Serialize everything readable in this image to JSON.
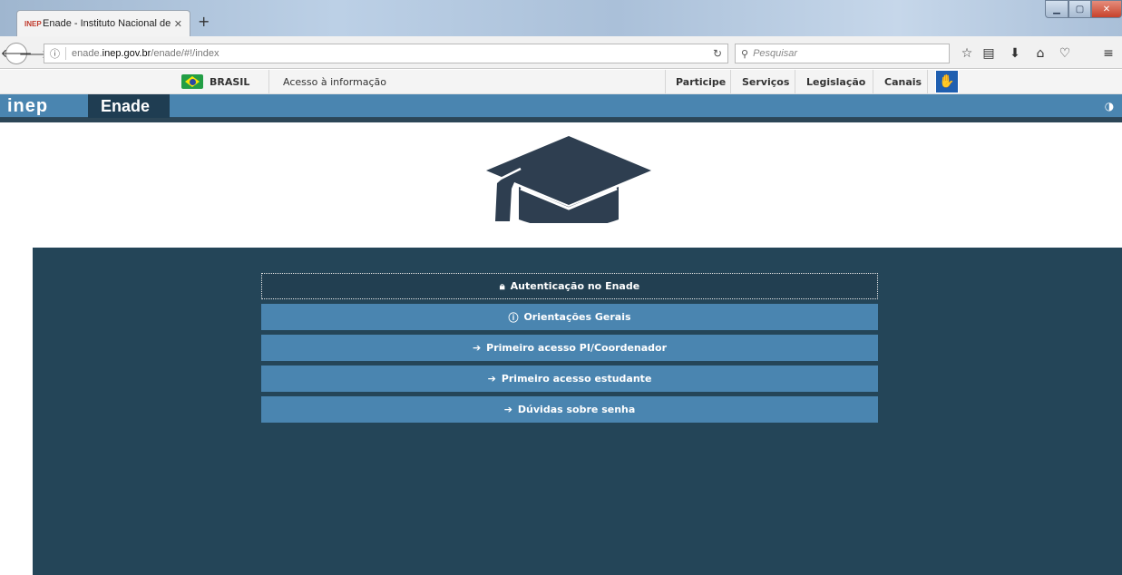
{
  "browser": {
    "tab_title": "Enade - Instituto Nacional de",
    "tab_favicon_text": "INEP",
    "url_info": "ⓘ",
    "url_domain_pre": "enade.",
    "url_domain_bold": "inep.gov.br",
    "url_path": "/enade/#!/index",
    "search_placeholder": "Pesquisar"
  },
  "govbar": {
    "country": "BRASIL",
    "access_info": "Acesso à informação",
    "links": [
      "Participe",
      "Serviços",
      "Legislação",
      "Canais"
    ]
  },
  "header": {
    "logo": "inep",
    "section": "Enade"
  },
  "menu": {
    "buttons": [
      {
        "label": "Autenticação no Enade",
        "icon": "lock-icon"
      },
      {
        "label": "Orientações Gerais",
        "icon": "info-icon"
      },
      {
        "label": "Primeiro acesso PI/Coordenador",
        "icon": "arrow-circle-right-icon"
      },
      {
        "label": "Primeiro acesso estudante",
        "icon": "arrow-circle-right-icon"
      },
      {
        "label": "Dúvidas sobre senha",
        "icon": "arrow-circle-right-icon"
      }
    ]
  },
  "colors": {
    "header_blue": "#4a85b0",
    "panel_dark": "#244558",
    "cap": "#2e3e50"
  }
}
